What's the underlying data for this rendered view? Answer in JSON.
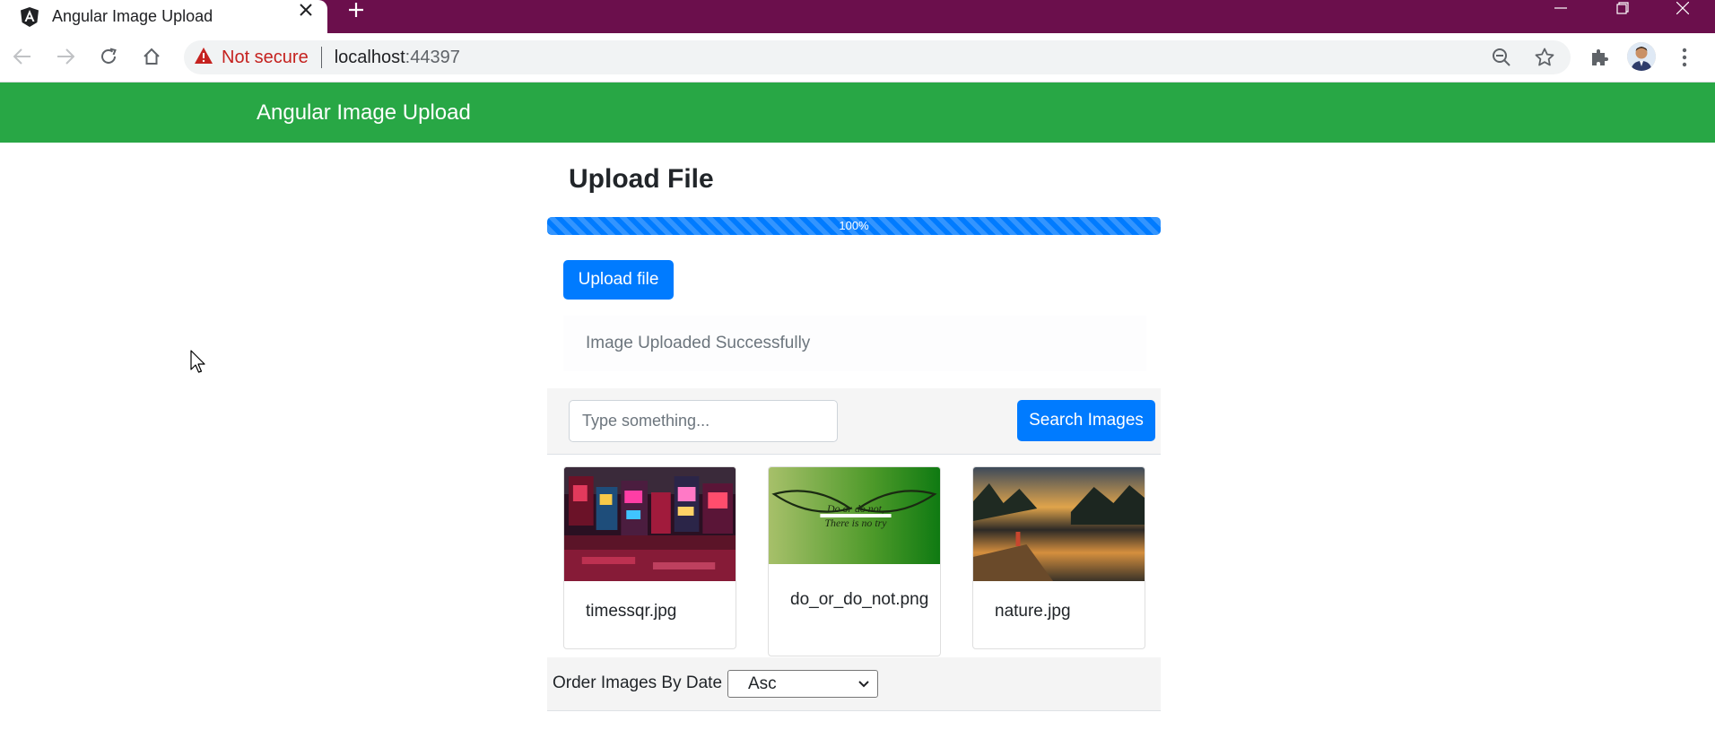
{
  "browser": {
    "tab_title": "Angular Image Upload",
    "security_label": "Not secure",
    "url_host": "localhost",
    "url_port": ":44397"
  },
  "app": {
    "brand": "Angular Image Upload",
    "heading": "Upload File",
    "progress": {
      "value": 100,
      "label": "100%"
    },
    "upload_button": "Upload file",
    "alert_text": "Image Uploaded Successfully",
    "search": {
      "placeholder": "Type something...",
      "button": "Search Images"
    },
    "images": [
      {
        "name": "timessqr.jpg"
      },
      {
        "name": "do_or_do_not.png",
        "caption": "Do or do not, There is no try"
      },
      {
        "name": "nature.jpg"
      }
    ],
    "order": {
      "label": "Order Images By Date :",
      "selected": "Asc"
    }
  },
  "colors": {
    "tabstrip": "#6b0f4c",
    "navbar": "#28a745",
    "primary": "#007bff"
  }
}
